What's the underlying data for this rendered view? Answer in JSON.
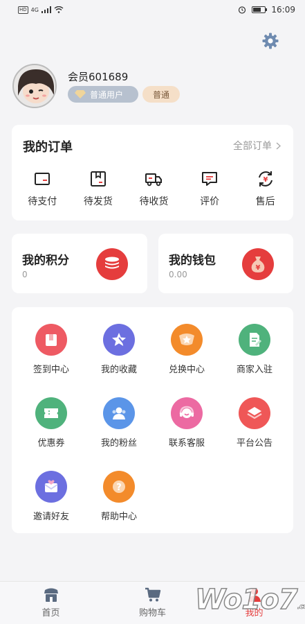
{
  "status_bar": {
    "time": "16:09",
    "network": "4G",
    "hd": "HD"
  },
  "profile": {
    "username": "会员601689",
    "level_badge": "普通用户",
    "tag": "普通"
  },
  "orders": {
    "title": "我的订单",
    "all_label": "全部订单",
    "items": [
      {
        "label": "待支付",
        "icon": "wallet-card-icon"
      },
      {
        "label": "待发货",
        "icon": "box-icon"
      },
      {
        "label": "待收货",
        "icon": "truck-icon"
      },
      {
        "label": "评价",
        "icon": "comment-icon"
      },
      {
        "label": "售后",
        "icon": "refund-icon"
      }
    ]
  },
  "points": {
    "title": "我的积分",
    "value": "0"
  },
  "wallet": {
    "title": "我的钱包",
    "value": "0.00"
  },
  "services": [
    {
      "label": "签到中心",
      "color": "#ee5a63",
      "icon": "calendar-icon"
    },
    {
      "label": "我的收藏",
      "color": "#6c6fe0",
      "icon": "star-icon"
    },
    {
      "label": "兑换中心",
      "color": "#f38b2b",
      "icon": "gift-star-icon"
    },
    {
      "label": "商家入驻",
      "color": "#4fb27c",
      "icon": "document-icon"
    },
    {
      "label": "优惠券",
      "color": "#4fb27c",
      "icon": "ticket-icon"
    },
    {
      "label": "我的粉丝",
      "color": "#5b95e8",
      "icon": "people-icon"
    },
    {
      "label": "联系客服",
      "color": "#ec6aa2",
      "icon": "headset-icon"
    },
    {
      "label": "平台公告",
      "color": "#ef5757",
      "icon": "layers-icon"
    },
    {
      "label": "邀请好友",
      "color": "#6c6fe0",
      "icon": "invite-mail-icon"
    },
    {
      "label": "帮助中心",
      "color": "#f38b2b",
      "icon": "question-icon"
    }
  ],
  "tabbar": {
    "items": [
      {
        "label": "首页",
        "icon": "home-icon"
      },
      {
        "label": "购物车",
        "icon": "cart-icon"
      },
      {
        "label": "我的",
        "icon": "person-icon"
      }
    ]
  },
  "watermark": {
    "text": "Wo1o7",
    "suffix": ".com"
  },
  "colors": {
    "accent": "#e53d3d",
    "background": "#f4f4f6"
  }
}
